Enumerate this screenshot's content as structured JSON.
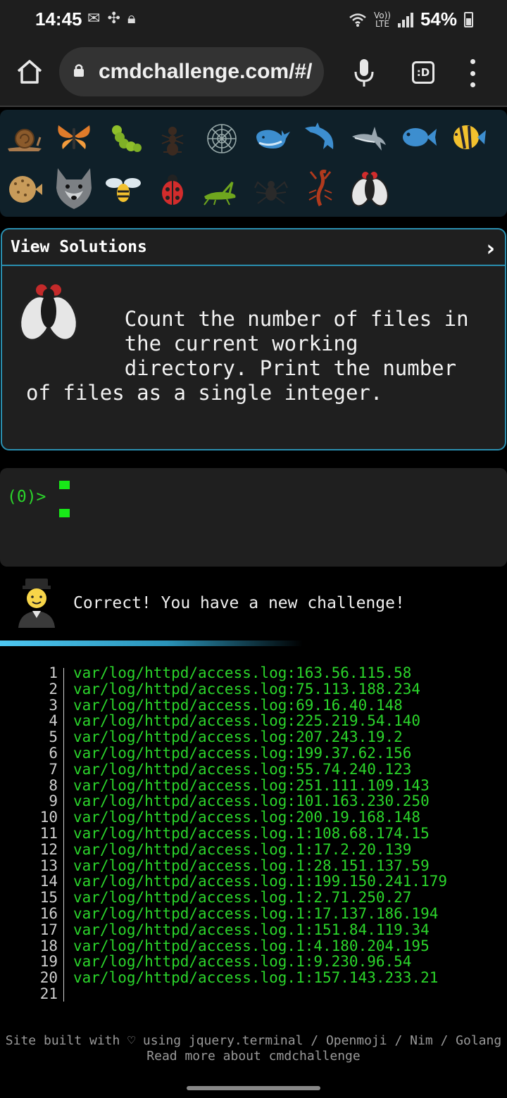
{
  "status_bar": {
    "time": "14:45",
    "network_small": "Vo)) LTE",
    "battery": "54%"
  },
  "browser": {
    "url": "cmdchallenge.com/#/",
    "tabs_label": ":D"
  },
  "emoji_panel": {
    "row1": [
      "snail-icon",
      "butterfly-icon",
      "caterpillar-icon",
      "ant-icon",
      "spider-web-icon",
      "whale-icon",
      "dolphin-icon",
      "shark-icon",
      "fish-icon",
      "tropical-fish-icon"
    ],
    "row2": [
      "blowfish-icon",
      "wolf-icon",
      "bee-icon",
      "ladybug-icon",
      "cricket-icon",
      "spider-icon",
      "scorpion-icon",
      "fly-icon"
    ]
  },
  "card": {
    "title": "View Solutions",
    "chevron": "›",
    "challenge": "        Count the number of files in\n        the current working\n        directory. Print the number\nof files as a single integer."
  },
  "terminal": {
    "prompt": "(0)>"
  },
  "result": {
    "message": "Correct! You have a new challenge!"
  },
  "output": {
    "line_numbers": [
      "1",
      "2",
      "3",
      "4",
      "5",
      "6",
      "7",
      "8",
      "9",
      "10",
      "11",
      "12",
      "13",
      "14",
      "15",
      "16",
      "17",
      "18",
      "19",
      "20",
      "21"
    ],
    "lines": [
      "var/log/httpd/access.log:163.56.115.58",
      "var/log/httpd/access.log:75.113.188.234",
      "var/log/httpd/access.log:69.16.40.148",
      "var/log/httpd/access.log:225.219.54.140",
      "var/log/httpd/access.log:207.243.19.2",
      "var/log/httpd/access.log:199.37.62.156",
      "var/log/httpd/access.log:55.74.240.123",
      "var/log/httpd/access.log:251.111.109.143",
      "var/log/httpd/access.log:101.163.230.250",
      "var/log/httpd/access.log:200.19.168.148",
      "var/log/httpd/access.log.1:108.68.174.15",
      "var/log/httpd/access.log.1:17.2.20.139",
      "var/log/httpd/access.log.1:28.151.137.59",
      "var/log/httpd/access.log.1:199.150.241.179",
      "var/log/httpd/access.log.1:2.71.250.27",
      "var/log/httpd/access.log.1:17.137.186.194",
      "var/log/httpd/access.log.1:151.84.119.34",
      "var/log/httpd/access.log.1:4.180.204.195",
      "var/log/httpd/access.log.1:9.230.96.54",
      "var/log/httpd/access.log.1:157.143.233.21",
      ""
    ]
  },
  "footer": {
    "line1": "Site built with ♡ using jquery.terminal / Openmoji / Nim / Golang",
    "line2": "Read more about cmdchallenge"
  }
}
